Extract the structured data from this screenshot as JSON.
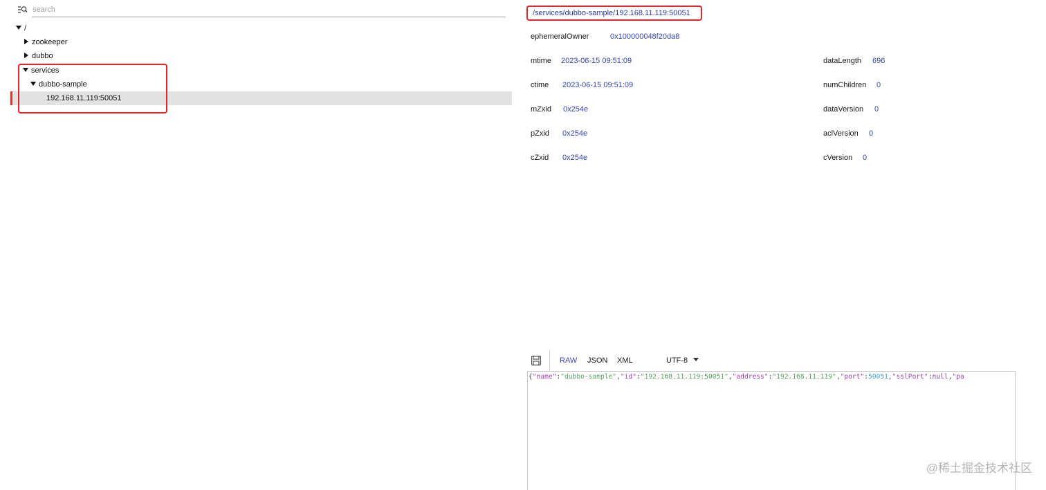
{
  "search": {
    "placeholder": "search",
    "icon": "search-list-icon"
  },
  "tree": {
    "root": "/",
    "nodes": [
      {
        "label": "zookeeper",
        "expanded": false
      },
      {
        "label": "dubbo",
        "expanded": false
      },
      {
        "label": "services",
        "expanded": true
      },
      {
        "label": "dubbo-sample",
        "expanded": true
      },
      {
        "label": "192.168.11.119:50051",
        "selected": true
      }
    ]
  },
  "detail": {
    "path": "/services/dubbo-sample/192.168.11.119:50051",
    "ephemeralOwner": {
      "label": "ephemeralOwner",
      "value": "0x100000048f20da8"
    },
    "left": [
      {
        "label": "mtime",
        "value": "2023-06-15 09:51:09"
      },
      {
        "label": "ctime",
        "value": "2023-06-15 09:51:09"
      },
      {
        "label": "mZxid",
        "value": "0x254e"
      },
      {
        "label": "pZxid",
        "value": "0x254e"
      },
      {
        "label": "cZxid",
        "value": "0x254e"
      }
    ],
    "right": [
      {
        "label": "dataLength",
        "value": "696"
      },
      {
        "label": "numChildren",
        "value": "0"
      },
      {
        "label": "dataVersion",
        "value": "0"
      },
      {
        "label": "aclVersion",
        "value": "0"
      },
      {
        "label": "cVersion",
        "value": "0"
      }
    ]
  },
  "editor": {
    "save_icon": "save-icon",
    "formats": [
      "RAW",
      "JSON",
      "XML"
    ],
    "active_format": "RAW",
    "encoding": "UTF-8",
    "content": {
      "open": "{",
      "k1": "\"name\"",
      "c1": ":",
      "v1": "\"dubbo-sample\"",
      "s1": ",",
      "k2": "\"id\"",
      "c2": ":",
      "v2": "\"192.168.11.119:50051\"",
      "s2": ",",
      "k3": "\"address\"",
      "c3": ":",
      "v3": "\"192.168.11.119\"",
      "s3": ",",
      "k4": "\"port\"",
      "c4": ":",
      "v4": "50051",
      "s4": ",",
      "k5": "\"sslPort\"",
      "c5": ":",
      "v5": "null",
      "s5": ",",
      "k6": "\"pa"
    }
  },
  "colors": {
    "highlight": "#e3262a",
    "link": "#3347b0",
    "selected_row": "#e2e2e2"
  },
  "watermark": "@稀土掘金技术社区"
}
